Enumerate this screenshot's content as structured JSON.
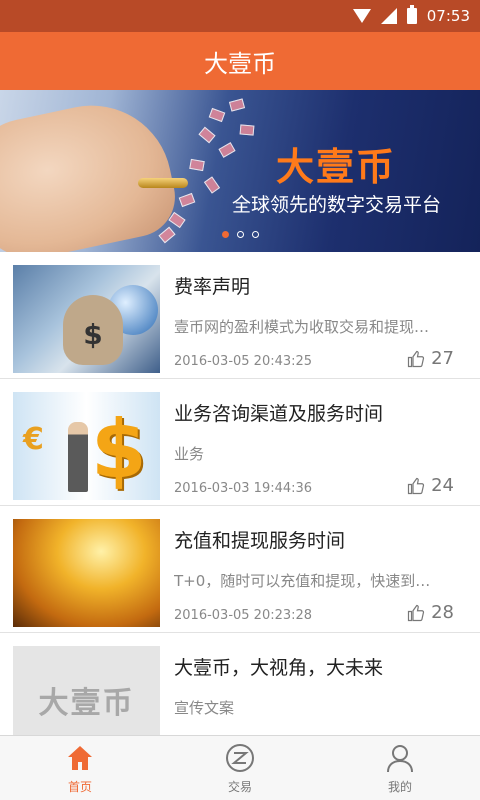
{
  "status_bar": {
    "time": "07:53"
  },
  "app_bar": {
    "title": "大壹币"
  },
  "banner": {
    "title": "大壹币",
    "subtitle": "全球领先的数字交易平台",
    "page_count": 3,
    "active_index": 0
  },
  "articles": [
    {
      "title": "费率声明",
      "description": "壹币网的盈利模式为收取交易和提现…",
      "date": "2016-03-05 20:43:25",
      "likes": "27"
    },
    {
      "title": "业务咨询渠道及服务时间",
      "description": "业务",
      "date": "2016-03-03 19:44:36",
      "likes": "24"
    },
    {
      "title": "充值和提现服务时间",
      "description": "T+0，随时可以充值和提现，快速到…",
      "date": "2016-03-05 20:23:28",
      "likes": "28"
    },
    {
      "title": "大壹币，大视角，大未来",
      "description": "宣传文案",
      "thumb_text": "大壹币"
    }
  ],
  "tabs": [
    {
      "label": "首页",
      "icon": "home-icon",
      "active": true
    },
    {
      "label": "交易",
      "icon": "trade-icon",
      "active": false
    },
    {
      "label": "我的",
      "icon": "profile-icon",
      "active": false
    }
  ],
  "colors": {
    "accent": "#ef6a34",
    "status_bar": "#b84a27"
  }
}
